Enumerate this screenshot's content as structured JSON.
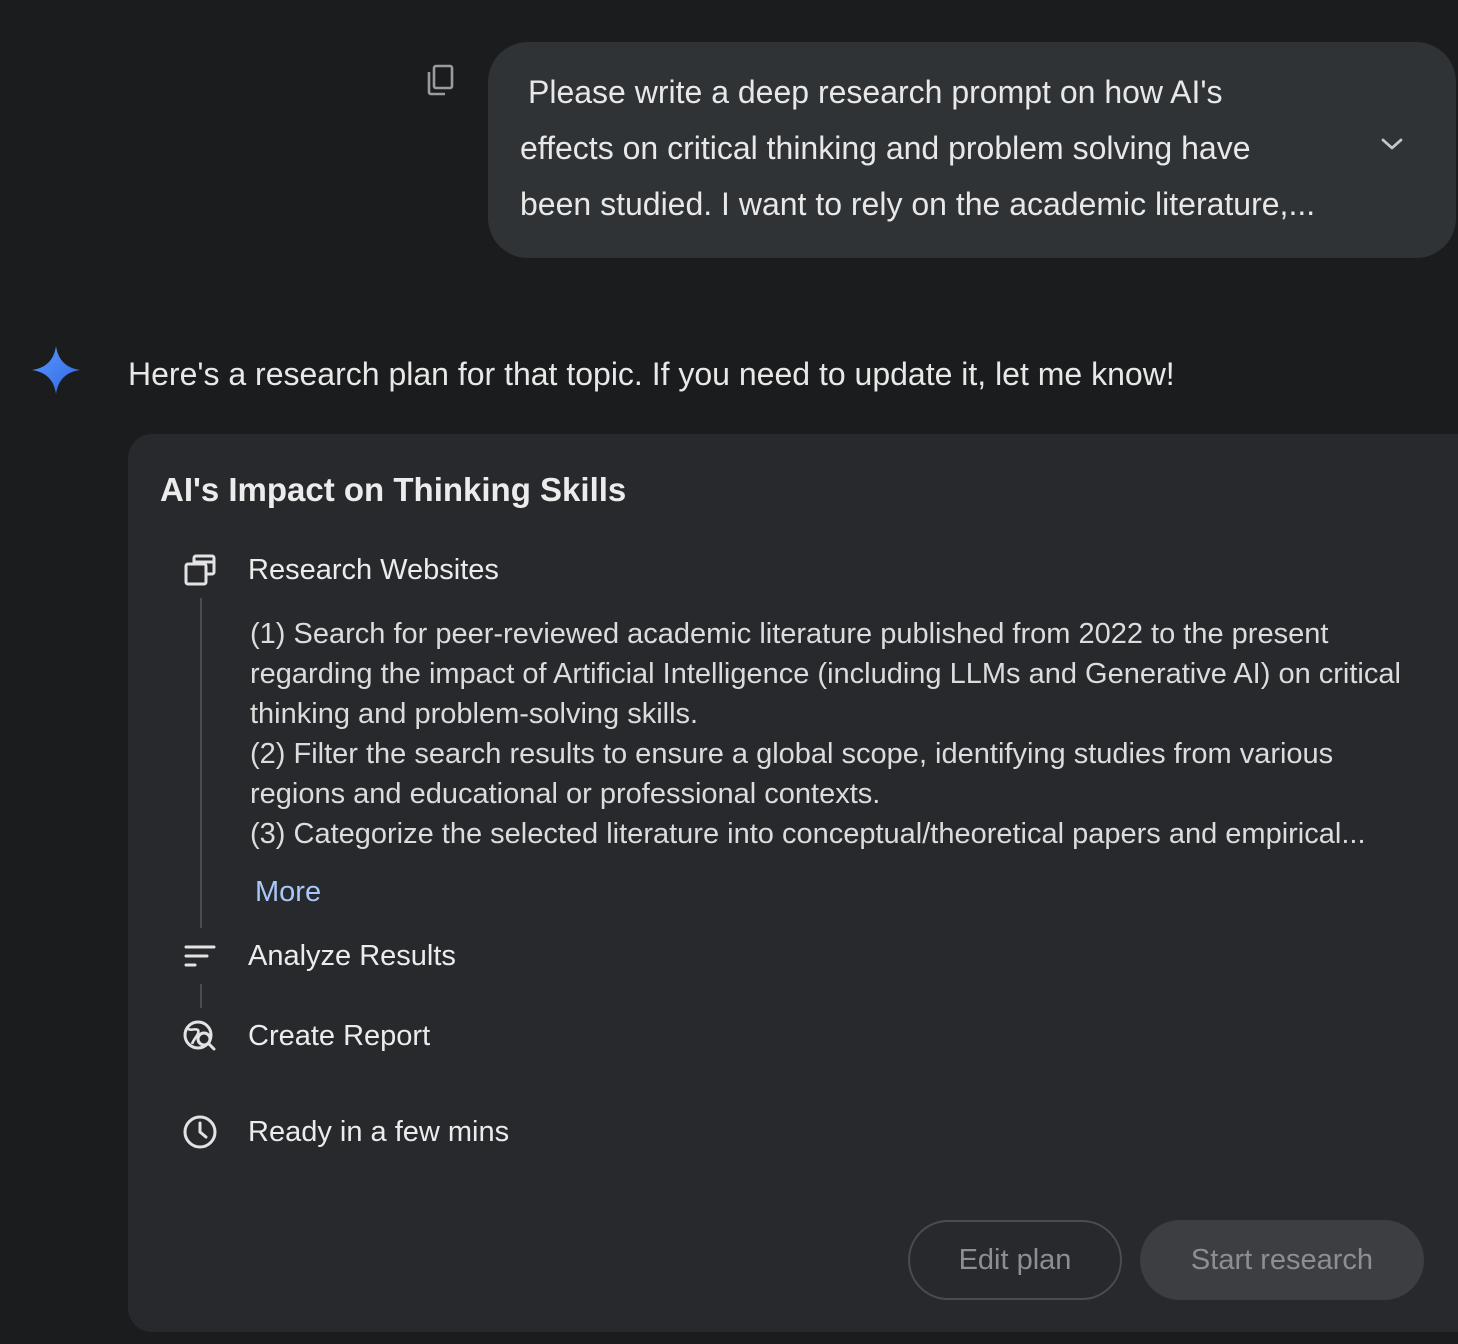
{
  "user_message": {
    "line1": "Please write a deep research prompt on how AI's",
    "line2": "effects on critical thinking and problem solving have",
    "line3": "been studied. I want to rely on the academic literature,..."
  },
  "icons": {
    "copy": "copy-icon",
    "expand": "chevron-down-icon",
    "assistant": "gemini-spark-icon",
    "research": "browser-windows-icon",
    "analyze": "sort-lines-icon",
    "report": "globe-search-icon",
    "time": "clock-icon"
  },
  "assistant": {
    "intro": "Here's a research plan for that topic. If you need to update it, let me know!"
  },
  "plan": {
    "title": "AI's Impact on Thinking Skills",
    "steps": [
      {
        "label": "Research Websites",
        "details": [
          "(1) Search for peer-reviewed academic literature published from 2022 to the present regarding the impact of Artificial Intelligence (including LLMs and Generative AI) on critical thinking and problem-solving skills.",
          "(2) Filter the search results to ensure a global scope, identifying studies from various regions and educational or professional contexts.",
          "(3) Categorize the selected literature into conceptual/theoretical papers and empirical..."
        ],
        "more_label": "More"
      },
      {
        "label": "Analyze Results"
      },
      {
        "label": "Create Report"
      }
    ],
    "eta": "Ready in a few mins",
    "edit_button": "Edit plan",
    "start_button": "Start research"
  },
  "colors": {
    "background": "#1b1c1d",
    "bubble": "#303335",
    "card": "#28292c",
    "link": "#a8c7fa",
    "spark_start": "#4f8df7",
    "spark_end": "#3a6ee8"
  }
}
